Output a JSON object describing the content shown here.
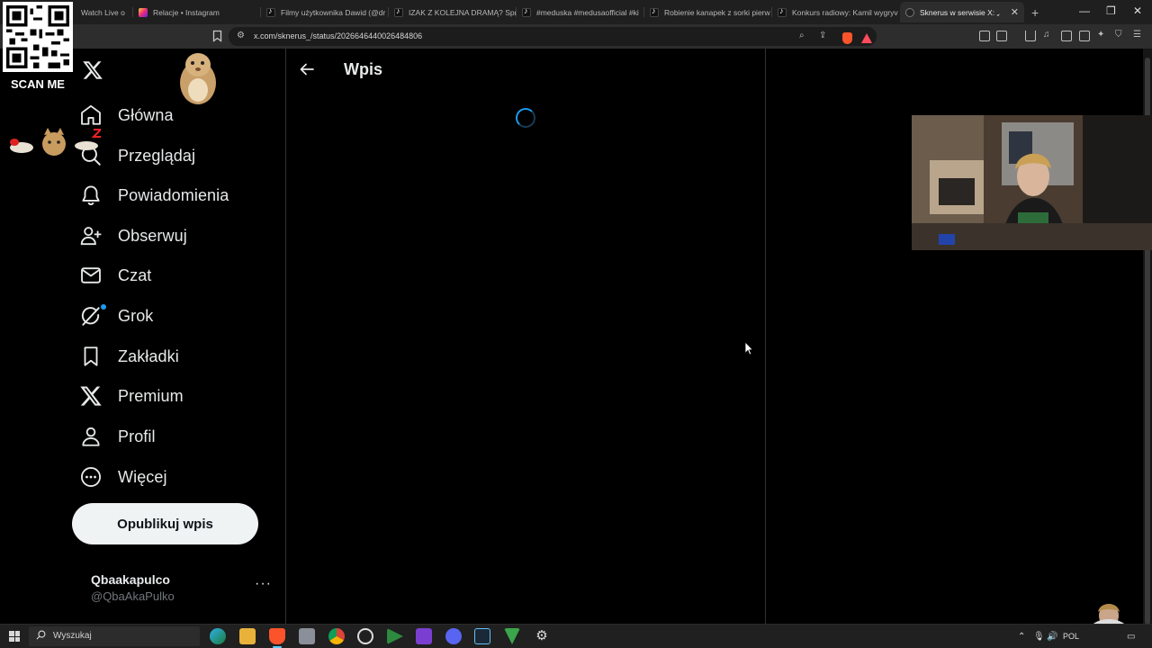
{
  "browser": {
    "tabs": [
      {
        "title": "Watch Live o",
        "icon": "x-tab-icon"
      },
      {
        "title": "Relacje • Instagram",
        "icon": "instagram-icon"
      },
      {
        "title": "Filmy użytkownika Dawid (@dr",
        "icon": "tiktok-icon"
      },
      {
        "title": "IZAK Z KOLEJNA DRAMĄ? Spra",
        "icon": "tiktok-icon"
      },
      {
        "title": "#meduska #medusaofficial #ki",
        "icon": "tiktok-icon"
      },
      {
        "title": "Robienie kanapek z sorki pierw",
        "icon": "tiktok-icon"
      },
      {
        "title": "Konkurs radiowy: Kamil wygryv",
        "icon": "tiktok-icon"
      },
      {
        "title": "Sknerus w serwisie X: „Ja",
        "icon": "x-tab-icon",
        "active": true
      }
    ],
    "url": "x.com/sknerus_/status/2026646440026484806"
  },
  "sidebar": {
    "items": [
      {
        "label": "Główna",
        "icon": "home-icon"
      },
      {
        "label": "Przeglądaj",
        "icon": "search-icon"
      },
      {
        "label": "Powiadomienia",
        "icon": "bell-icon"
      },
      {
        "label": "Obserwuj",
        "icon": "person-add-icon"
      },
      {
        "label": "Czat",
        "icon": "envelope-icon"
      },
      {
        "label": "Grok",
        "icon": "grok-icon"
      },
      {
        "label": "Zakładki",
        "icon": "bookmark-icon"
      },
      {
        "label": "Premium",
        "icon": "x-premium-icon"
      },
      {
        "label": "Profil",
        "icon": "person-icon"
      },
      {
        "label": "Więcej",
        "icon": "more-circle-icon"
      }
    ],
    "post_button": "Opublikuj wpis",
    "account": {
      "name": "Qbaakapulco",
      "handle": "@QbaAkaPulko"
    }
  },
  "main": {
    "title": "Wpis"
  },
  "overlay": {
    "qr_label": "SCAN ME"
  },
  "taskbar": {
    "search_placeholder": "Wyszukaj",
    "lang": "POL"
  },
  "colors": {
    "accent": "#1d9bf0",
    "background": "#000000",
    "text": "#e7e9ea",
    "muted": "#71767b",
    "border": "#2f3336"
  }
}
